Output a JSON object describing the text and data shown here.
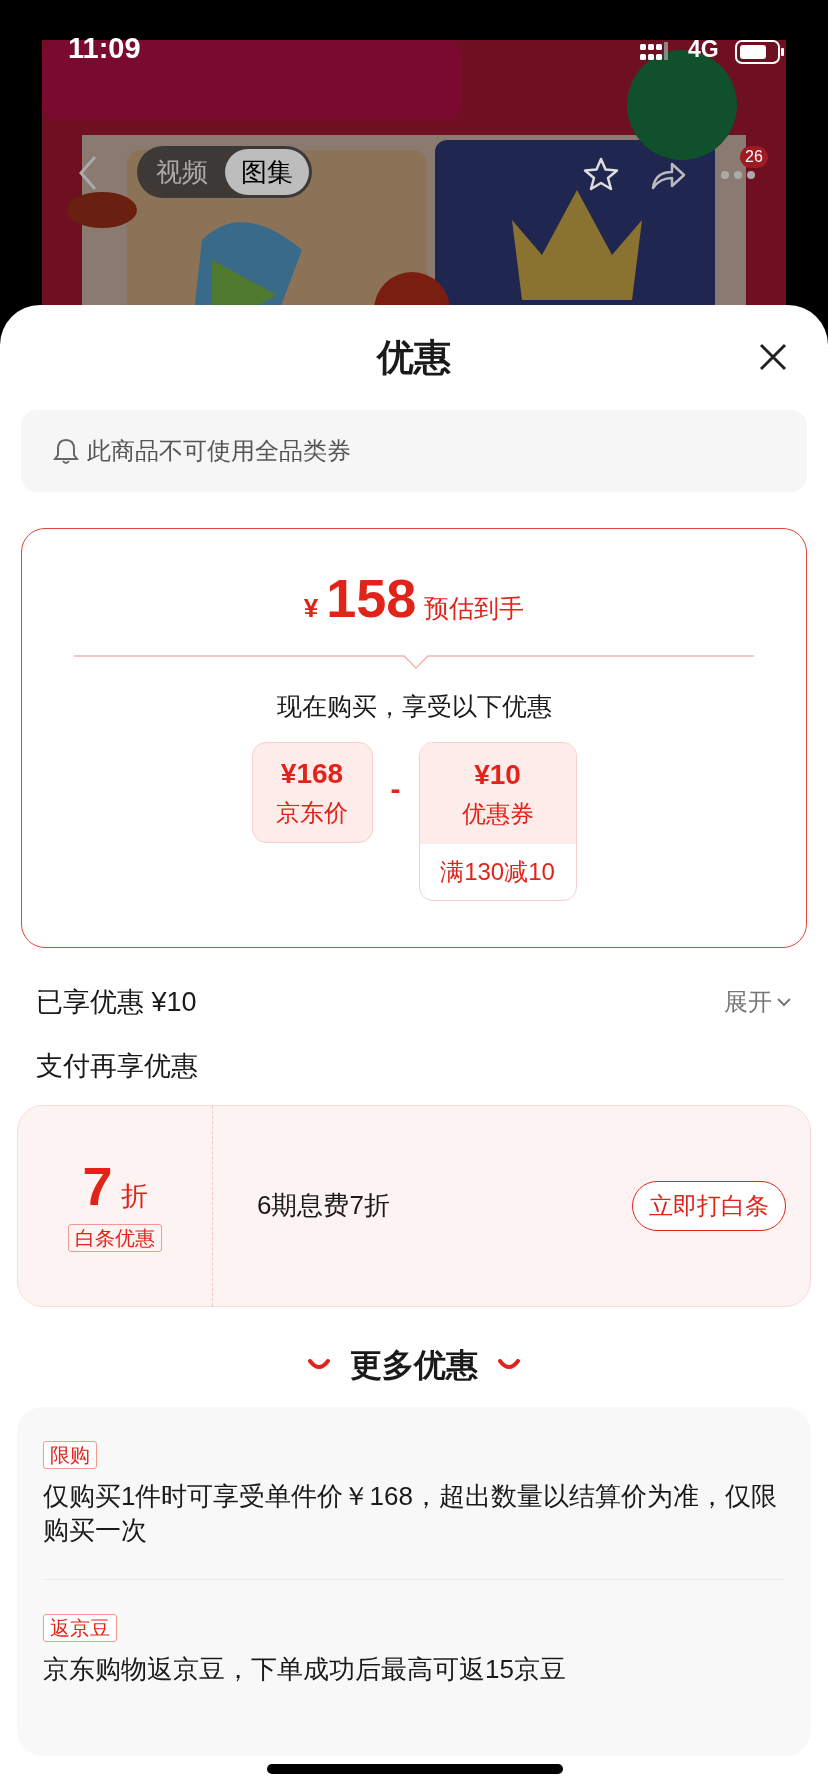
{
  "status_bar": {
    "time": "11:09",
    "network": "4G"
  },
  "gallery": {
    "tabs": [
      {
        "label": "视频",
        "selected": false
      },
      {
        "label": "图集",
        "selected": true
      }
    ],
    "badge": "26"
  },
  "sheet": {
    "title": "优惠",
    "notice": "此商品不可使用全品类券",
    "estimate": {
      "currency": "¥",
      "price": "158",
      "label": "预估到手"
    },
    "subtitle": "现在购买，享受以下优惠",
    "price_box": {
      "amount": "¥168",
      "label": "京东价"
    },
    "operator": "-",
    "coupon_box": {
      "amount": "¥10",
      "label": "优惠券",
      "condition": "满130减10"
    },
    "enjoyed": {
      "text": "已享优惠 ¥10",
      "toggle": "展开"
    },
    "pay_title": "支付再享优惠",
    "pay_offer": {
      "discount": "7",
      "unit": "折",
      "tag": "白条优惠",
      "description": "6期息费7折",
      "button": "立即打白条"
    },
    "more_title": "更多优惠",
    "more": [
      {
        "tag": "限购",
        "text": "仅购买1件时可享受单件价￥168，超出数量以结算价为准，仅限购买一次"
      },
      {
        "tag": "返京豆",
        "text": "京东购物返京豆，下单成功后最高可返15京豆"
      }
    ]
  }
}
